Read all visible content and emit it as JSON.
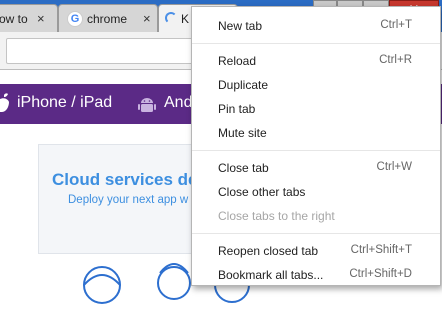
{
  "browser": {
    "tabs": [
      {
        "title": "ow to"
      },
      {
        "title": "chrome",
        "favicon_letter": "G"
      },
      {
        "title": "K"
      }
    ],
    "close_glyph": "×",
    "window_close_glyph": "✕"
  },
  "page": {
    "nav": {
      "link_1": "iPhone / iPad",
      "link_2": "And"
    },
    "promo": {
      "title": "Cloud services de",
      "subtitle": "Deploy your next app w"
    }
  },
  "context_menu": {
    "groups": [
      [
        {
          "label": "New tab",
          "shortcut": "Ctrl+T",
          "enabled": true
        }
      ],
      [
        {
          "label": "Reload",
          "shortcut": "Ctrl+R",
          "enabled": true
        },
        {
          "label": "Duplicate",
          "shortcut": "",
          "enabled": true
        },
        {
          "label": "Pin tab",
          "shortcut": "",
          "enabled": true
        },
        {
          "label": "Mute site",
          "shortcut": "",
          "enabled": true
        }
      ],
      [
        {
          "label": "Close tab",
          "shortcut": "Ctrl+W",
          "enabled": true
        },
        {
          "label": "Close other tabs",
          "shortcut": "",
          "enabled": true
        },
        {
          "label": "Close tabs to the right",
          "shortcut": "",
          "enabled": false
        }
      ],
      [
        {
          "label": "Reopen closed tab",
          "shortcut": "Ctrl+Shift+T",
          "enabled": true
        },
        {
          "label": "Bookmark all tabs...",
          "shortcut": "Ctrl+Shift+D",
          "enabled": true
        }
      ]
    ]
  },
  "colors": {
    "tabstrip": "#2b6cc4",
    "nav_band": "#5b2a86",
    "promo_text": "#3d8fe0",
    "window_close": "#c7382e"
  }
}
